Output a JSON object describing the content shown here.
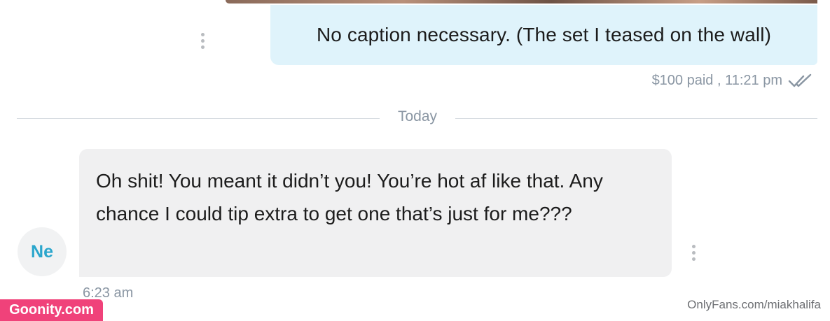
{
  "sent_message": {
    "text": "No caption necessary. (The set I teased on the wall)",
    "meta": "$100 paid , 11:21 pm",
    "read_icon": "double-check-icon"
  },
  "divider": {
    "label": "Today"
  },
  "received_message": {
    "avatar_initials": "Ne",
    "text": "Oh shit! You meant it didn’t you! You’re hot af like that. Any chance I could tip extra to get one that’s just for me???",
    "time": "6:23 am"
  },
  "watermarks": {
    "badge": "Goonity.com",
    "source": "OnlyFans.com/miakhalifa"
  },
  "colors": {
    "sent_bubble": "#dff3fb",
    "received_bubble": "#f0f0f1",
    "meta_text": "#8a96a3",
    "avatar_text": "#2aa6cc",
    "badge": "#f0427a"
  }
}
